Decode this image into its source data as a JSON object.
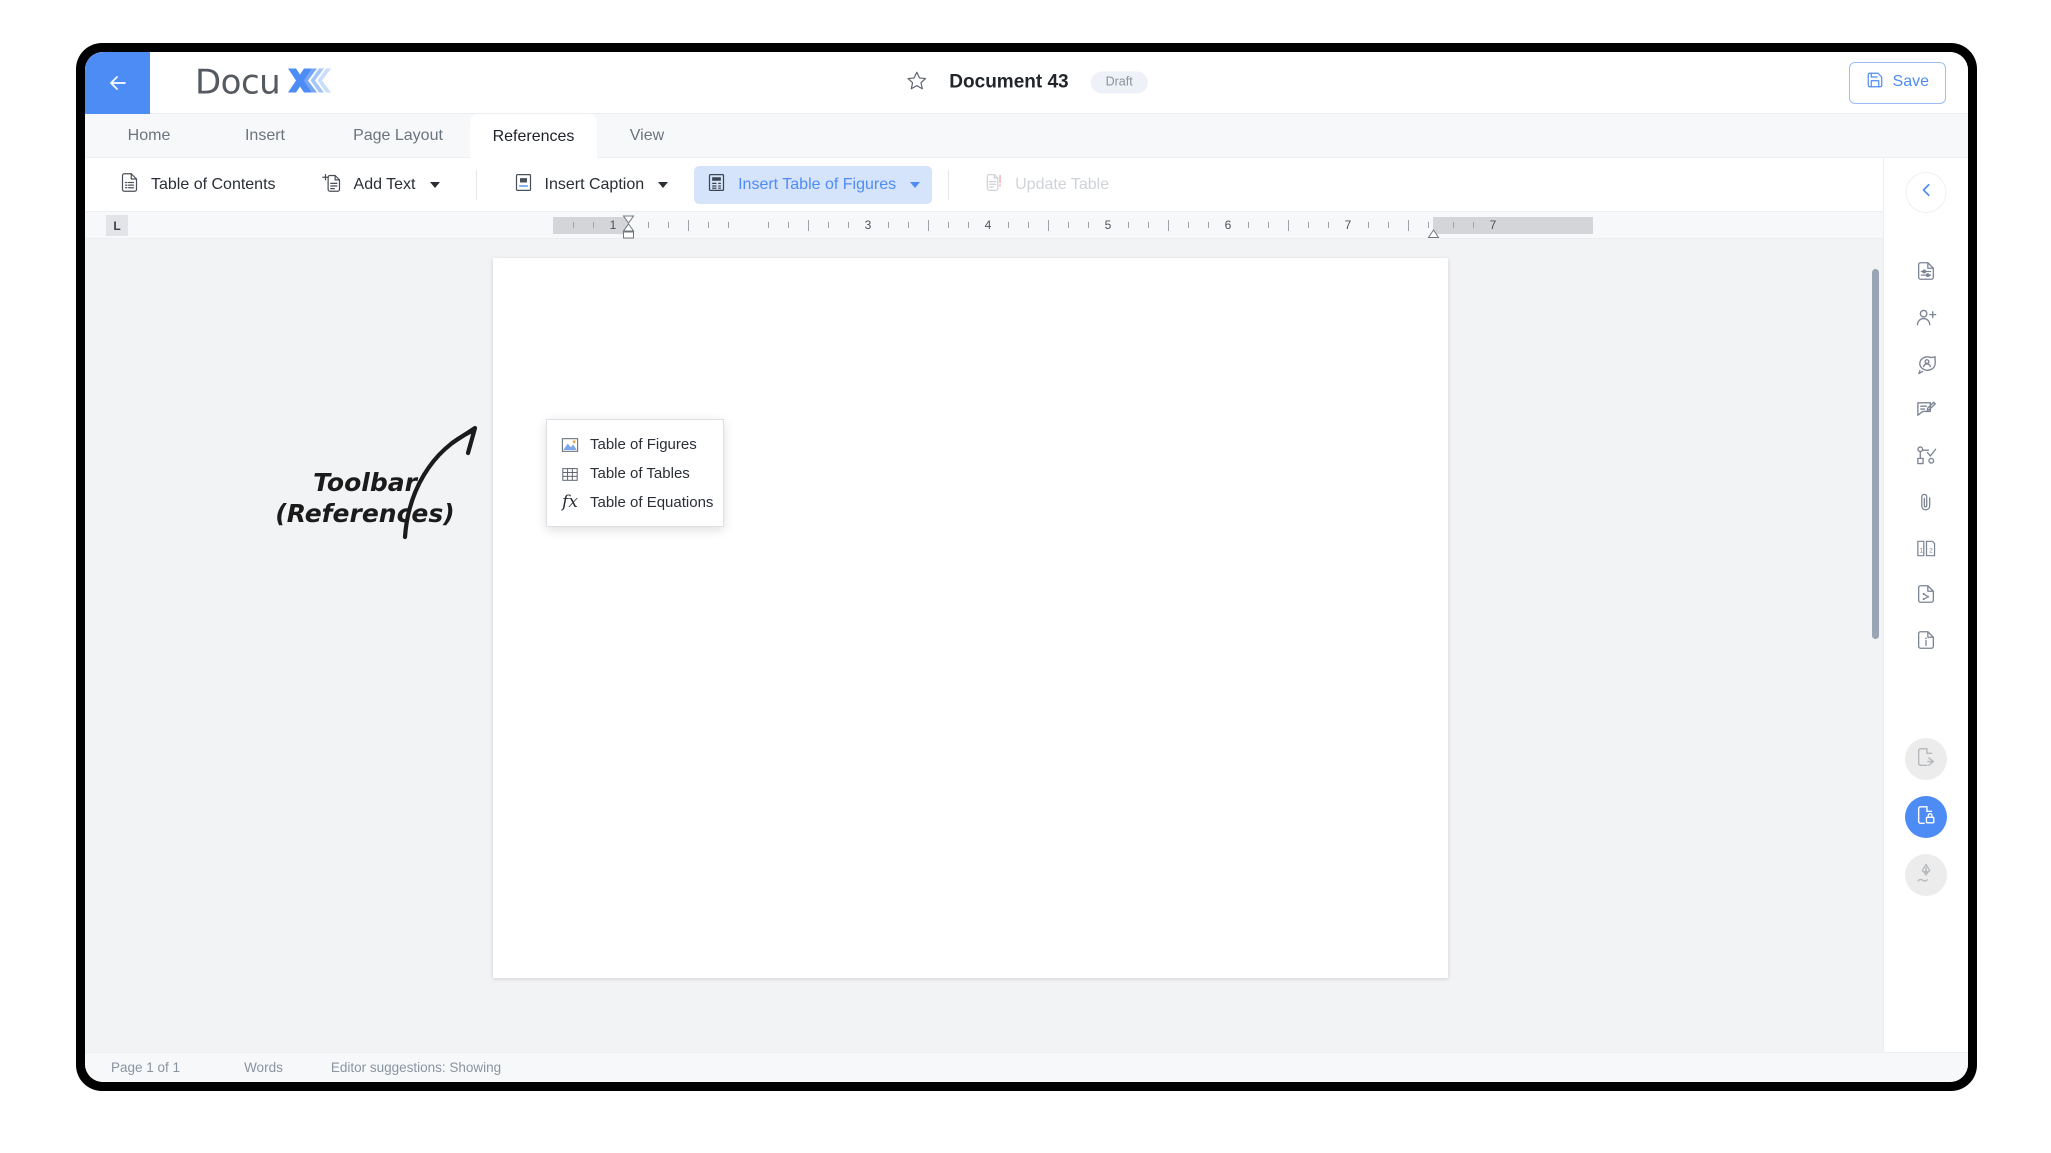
{
  "titlebar": {
    "back_icon": "arrow-left-icon",
    "brand_word": "Docu",
    "brand_mark_icon": "docux-logomark",
    "favorite_icon": "star-outline-icon",
    "document_title": "Document 43",
    "status_badge": "Draft",
    "save_label": "Save",
    "save_icon": "floppy-disk-icon"
  },
  "tabs": [
    {
      "label": "Home",
      "active": false
    },
    {
      "label": "Insert",
      "active": false
    },
    {
      "label": "Page Layout",
      "active": false
    },
    {
      "label": "References",
      "active": true
    },
    {
      "label": "View",
      "active": false
    }
  ],
  "toolbar": {
    "items": [
      {
        "label": "Table of Contents",
        "icon": "document-list-icon",
        "state": "normal",
        "caret": false
      },
      {
        "label": "Add Text",
        "icon": "document-add-icon",
        "state": "normal",
        "caret": true
      },
      {
        "label": "Insert Caption",
        "icon": "caption-box-icon",
        "state": "normal",
        "caret": true
      },
      {
        "label": "Insert Table of Figures",
        "icon": "table-of-figures-icon",
        "state": "active",
        "caret": true
      },
      {
        "label": "Update Table",
        "icon": "document-refresh-icon",
        "state": "disabled",
        "caret": false
      }
    ]
  },
  "dropdown": {
    "open": true,
    "items": [
      {
        "label": "Table of Figures",
        "icon": "image-picture-icon"
      },
      {
        "label": "Table of Tables",
        "icon": "grid-table-icon"
      },
      {
        "label": "Table of Equations",
        "icon": "fx-function-icon"
      }
    ]
  },
  "annotation": {
    "text": "Toolbar\n(References)",
    "arrow_icon": "curved-arrow-icon"
  },
  "ruler": {
    "corner_label": "L",
    "unit_numbers": [
      "1",
      "3",
      "4",
      "5",
      "6",
      "7"
    ],
    "left_margin_marker": "indent-marker-icon",
    "right_margin_marker": "indent-marker-icon"
  },
  "sidebar": {
    "collapse_icon": "chevron-left-icon",
    "icons": [
      "document-properties-icon",
      "add-person-icon",
      "comment-person-icon",
      "review-edit-icon",
      "workflow-approve-icon",
      "paperclip-attachment-icon",
      "compare-documents-icon",
      "document-version-icon",
      "document-info-icon"
    ],
    "fabs": [
      {
        "icon": "document-share-icon",
        "active": false
      },
      {
        "icon": "document-lock-icon",
        "active": true
      },
      {
        "icon": "signature-pen-icon",
        "active": false
      }
    ]
  },
  "statusbar": {
    "page_label": "Page 1 of 1",
    "words_label": "Words",
    "suggestions_label": "Editor suggestions: Showing"
  },
  "colors": {
    "accent": "#4e8cf5",
    "active_tool_bg": "#d6e4fb",
    "canvas_bg": "#f2f3f5",
    "chrome_bg": "#f7f8fa",
    "badge_bg": "#eef1f8",
    "disabled_text": "#cfd3d9"
  }
}
